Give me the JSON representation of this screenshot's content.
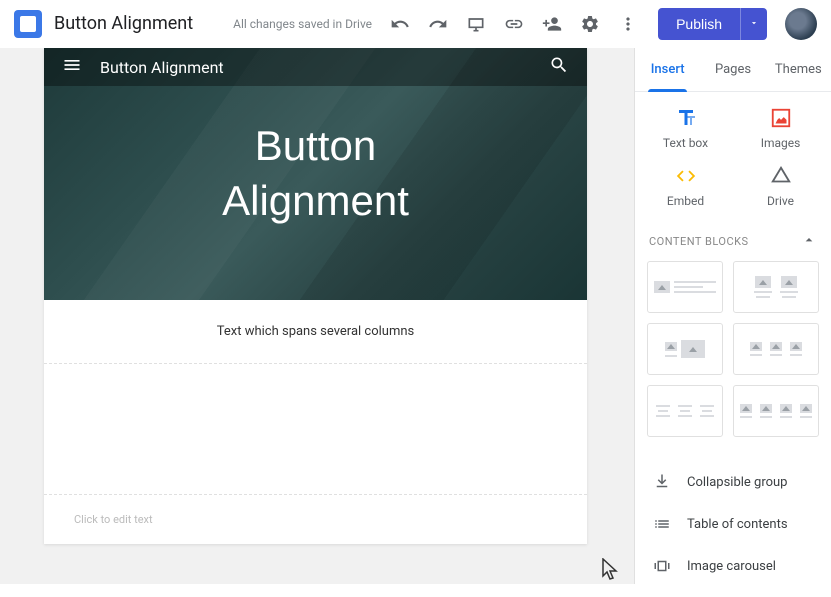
{
  "header": {
    "doc_title": "Button Alignment",
    "save_status": "All changes saved in Drive",
    "publish_label": "Publish"
  },
  "canvas": {
    "site_title": "Button Alignment",
    "hero_line1": "Button",
    "hero_line2": "Alignment",
    "section_text": "Text which spans several columns",
    "edit_placeholder": "Click to edit text"
  },
  "sidebar": {
    "tabs": {
      "insert": "Insert",
      "pages": "Pages",
      "themes": "Themes"
    },
    "inserts": {
      "textbox": "Text box",
      "images": "Images",
      "embed": "Embed",
      "drive": "Drive"
    },
    "content_blocks_label": "Content Blocks",
    "actions": {
      "collapsible": "Collapsible group",
      "toc": "Table of contents",
      "carousel": "Image carousel"
    }
  }
}
